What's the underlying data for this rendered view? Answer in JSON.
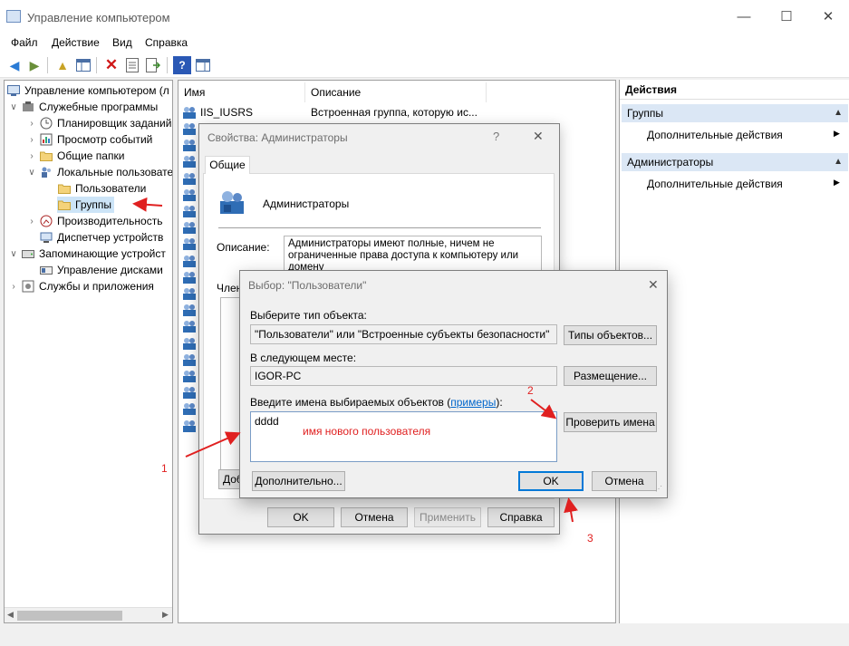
{
  "window": {
    "title": "Управление компьютером",
    "minimize": "—",
    "maximize": "☐",
    "close": "✕"
  },
  "menu": [
    "Файл",
    "Действие",
    "Вид",
    "Справка"
  ],
  "tree": {
    "root": "Управление компьютером (л",
    "items": [
      "Служебные программы",
      "Планировщик заданий",
      "Просмотр событий",
      "Общие папки",
      "Локальные пользовате",
      "Пользователи",
      "Группы",
      "Производительность",
      "Диспетчер устройств",
      "Запоминающие устройст",
      "Управление дисками",
      "Службы и приложения"
    ]
  },
  "list": {
    "headers": [
      "Имя",
      "Описание"
    ],
    "first_row": {
      "name": "IIS_IUSRS",
      "desc": "Встроенная группа, которую ис..."
    }
  },
  "actions": {
    "title": "Действия",
    "sections": [
      {
        "title": "Группы",
        "item": "Дополнительные действия"
      },
      {
        "title": "Администраторы",
        "item": "Дополнительные действия"
      }
    ]
  },
  "props_dialog": {
    "title": "Свойства: Администраторы",
    "help": "?",
    "tab": "Общие",
    "group_name": "Администраторы",
    "desc_label": "Описание:",
    "desc_value": "Администраторы имеют полные, ничем не ограниченные права доступа к компьютеру или домену",
    "members_label": "Член",
    "add_label": "Доб",
    "ok": "OK",
    "cancel": "Отмена",
    "apply": "Применить",
    "help_btn": "Справка"
  },
  "select_dialog": {
    "title": "Выбор: \"Пользователи\"",
    "object_type_label": "Выберите тип объекта:",
    "object_type_value": "\"Пользователи\" или \"Встроенные субъекты безопасности\"",
    "object_types_btn": "Типы объектов...",
    "location_label": "В следующем месте:",
    "location_value": "IGOR-PC",
    "location_btn": "Размещение...",
    "names_label_pre": "Введите имена выбираемых объектов (",
    "names_label_link": "примеры",
    "names_label_post": "):",
    "names_value": "dddd",
    "check_names_btn": "Проверить имена",
    "advanced_btn": "Дополнительно...",
    "ok": "OK",
    "cancel": "Отмена"
  },
  "annotations": {
    "new_user_note": "имя нового пользователя",
    "n1": "1",
    "n2": "2",
    "n3": "3",
    "color": "#e02020"
  }
}
